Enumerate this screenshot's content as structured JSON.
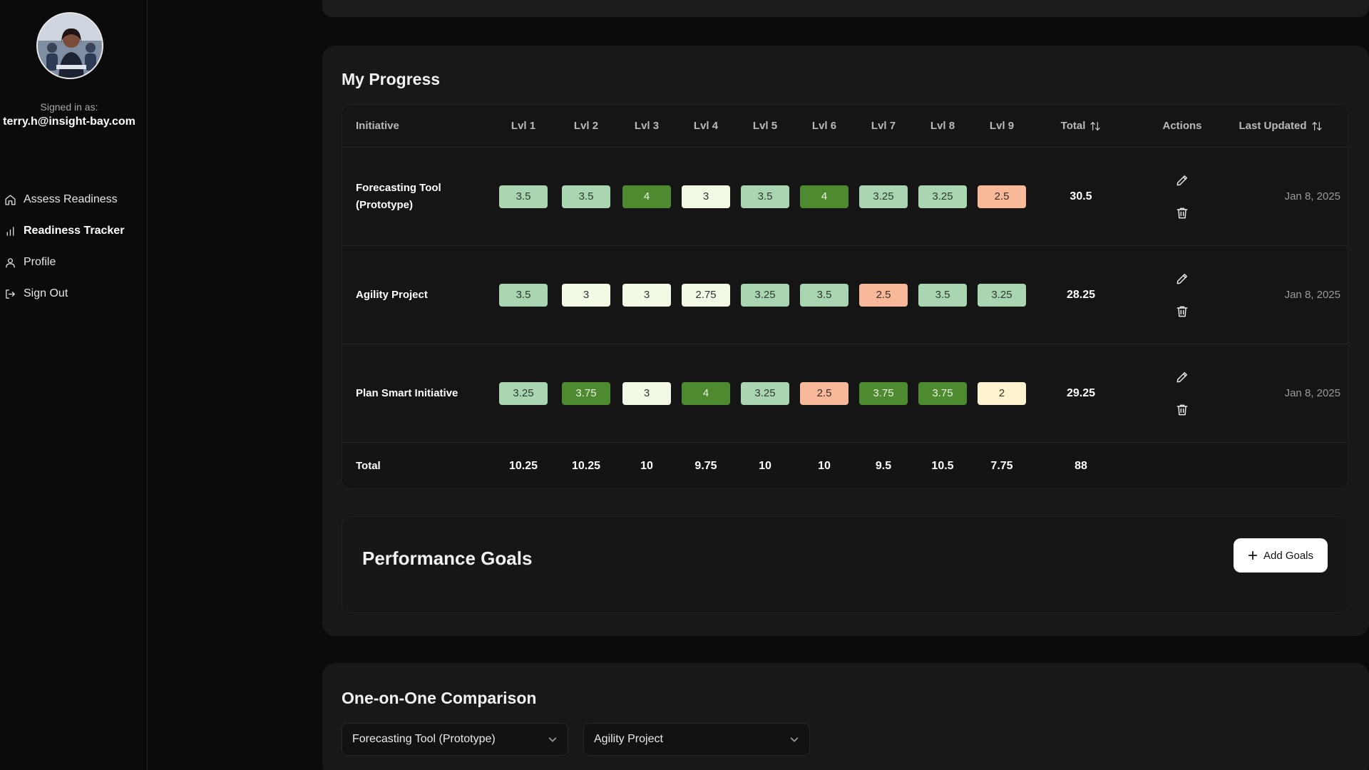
{
  "sidebar": {
    "signed_in_label": "Signed in as:",
    "email": "terry.h@insight-bay.com",
    "nav": [
      {
        "label": "Assess Readiness",
        "icon": "home-icon"
      },
      {
        "label": "Readiness Tracker",
        "icon": "bar-chart-icon",
        "active": true
      },
      {
        "label": "Profile",
        "icon": "user-icon"
      },
      {
        "label": "Sign Out",
        "icon": "sign-out-icon"
      }
    ]
  },
  "progress": {
    "title": "My Progress",
    "headers": {
      "initiative": "Initiative",
      "levels": [
        "Lvl 1",
        "Lvl 2",
        "Lvl 3",
        "Lvl 4",
        "Lvl 5",
        "Lvl 6",
        "Lvl 7",
        "Lvl 8",
        "Lvl 9"
      ],
      "total": "Total",
      "actions": "Actions",
      "last_updated": "Last Updated"
    },
    "rows": [
      {
        "name_line1": "Forecasting Tool",
        "name_line2": "(Prototype)",
        "scores": [
          "3.5",
          "3.5",
          "4",
          "3",
          "3.5",
          "4",
          "3.25",
          "3.25",
          "2.5"
        ],
        "total": "30.5",
        "updated": "Jan 8, 2025"
      },
      {
        "name_line1": "Agility Project",
        "name_line2": "",
        "scores": [
          "3.5",
          "3",
          "3",
          "2.75",
          "3.25",
          "3.5",
          "2.5",
          "3.5",
          "3.25"
        ],
        "total": "28.25",
        "updated": "Jan 8, 2025"
      },
      {
        "name_line1": "Plan Smart Initiative",
        "name_line2": "",
        "scores": [
          "3.25",
          "3.75",
          "3",
          "4",
          "3.25",
          "2.5",
          "3.75",
          "3.75",
          "2"
        ],
        "total": "29.25",
        "updated": "Jan 8, 2025"
      }
    ],
    "totals": {
      "label": "Total",
      "values": [
        "10.25",
        "10.25",
        "10",
        "9.75",
        "10",
        "10",
        "9.5",
        "10.5",
        "7.75"
      ],
      "grand_total": "88"
    },
    "score_colors": {
      "4": {
        "bg": "#4e8a2f",
        "fg": "#e8f5e0"
      },
      "3.75": {
        "bg": "#4e8a2f",
        "fg": "#e8f5e0"
      },
      "3.5": {
        "bg": "#a9d6b0",
        "fg": "#2d3a2f"
      },
      "3.25": {
        "bg": "#a9d6b0",
        "fg": "#2d3a2f"
      },
      "3": {
        "bg": "#f2fae6",
        "fg": "#333333"
      },
      "2.75": {
        "bg": "#f2fae6",
        "fg": "#333333"
      },
      "2.5": {
        "bg": "#f7b99a",
        "fg": "#3a2a22"
      },
      "2": {
        "bg": "#fdf4cf",
        "fg": "#3a3420"
      }
    }
  },
  "goals": {
    "title": "Performance Goals",
    "add_label": "Add Goals"
  },
  "comparison": {
    "title": "One-on-One Comparison",
    "select_a": "Forecasting Tool (Prototype)",
    "select_b": "Agility Project"
  }
}
